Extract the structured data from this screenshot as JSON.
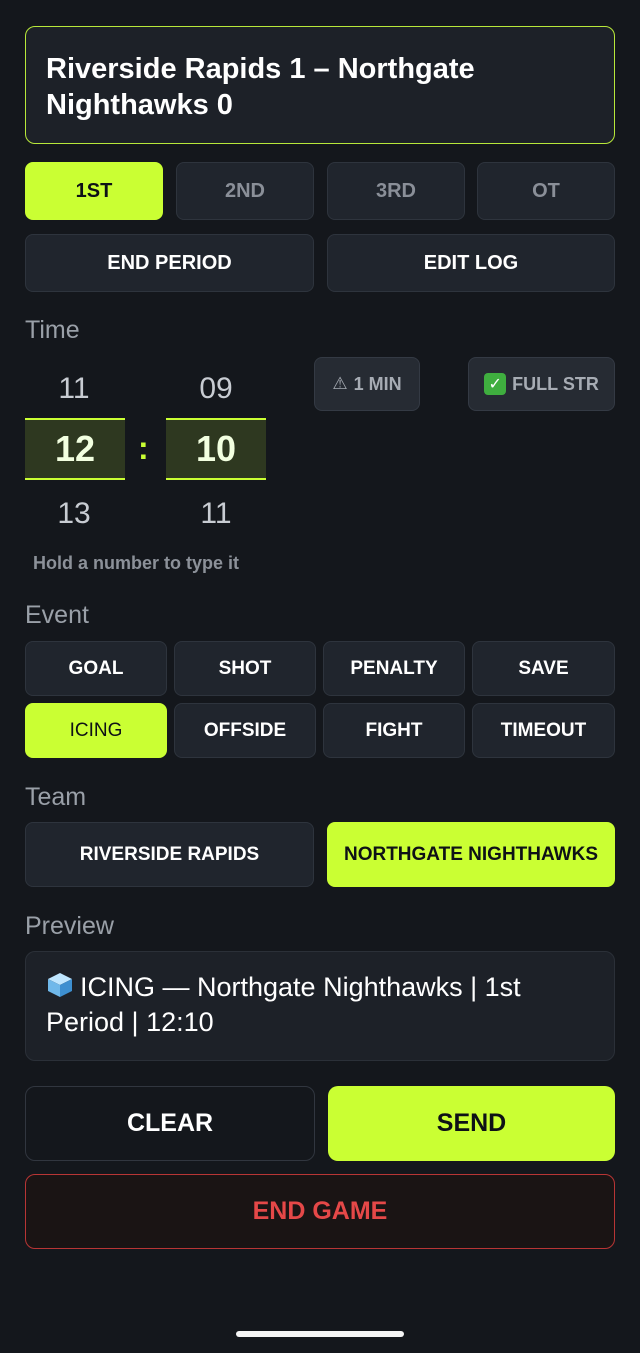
{
  "scoreboard": {
    "title": "Riverside Rapids 1 – Northgate Nighthawks 0"
  },
  "periods": [
    {
      "label": "1ST",
      "active": true
    },
    {
      "label": "2ND",
      "active": false
    },
    {
      "label": "3RD",
      "active": false
    },
    {
      "label": "OT",
      "active": false
    }
  ],
  "period_actions": {
    "end_period": "END PERIOD",
    "edit_log": "EDIT LOG"
  },
  "time": {
    "section_label": "Time",
    "minutes": {
      "prev": "11",
      "selected": "12",
      "next": "13"
    },
    "separator": ":",
    "seconds": {
      "prev": "09",
      "selected": "10",
      "next": "11"
    },
    "hint": "Hold a number to type it",
    "chips": {
      "one_min": {
        "icon": "warning-icon",
        "glyph": "⚠",
        "label": "1 MIN"
      },
      "full_str": {
        "icon": "check-box-icon",
        "glyph": "✓",
        "label": "FULL STR"
      }
    }
  },
  "event": {
    "section_label": "Event",
    "options": [
      {
        "label": "GOAL",
        "active": false
      },
      {
        "label": "SHOT",
        "active": false
      },
      {
        "label": "PENALTY",
        "active": false
      },
      {
        "label": "SAVE",
        "active": false
      },
      {
        "label": "ICING",
        "active": true
      },
      {
        "label": "OFFSIDE",
        "active": false
      },
      {
        "label": "FIGHT",
        "active": false
      },
      {
        "label": "TIMEOUT",
        "active": false
      }
    ]
  },
  "team": {
    "section_label": "Team",
    "options": [
      {
        "label": "RIVERSIDE RAPIDS",
        "active": false
      },
      {
        "label": "NORTHGATE NIGHTHAWKS",
        "active": true
      }
    ]
  },
  "preview": {
    "section_label": "Preview",
    "icon": "ice-cube-icon",
    "text": "ICING — Northgate Nighthawks | 1st Period | 12:10"
  },
  "actions": {
    "clear": "CLEAR",
    "send": "SEND",
    "end_game": "END GAME"
  },
  "colors": {
    "accent": "#caff33",
    "background": "#14171c",
    "danger": "#e54848"
  }
}
